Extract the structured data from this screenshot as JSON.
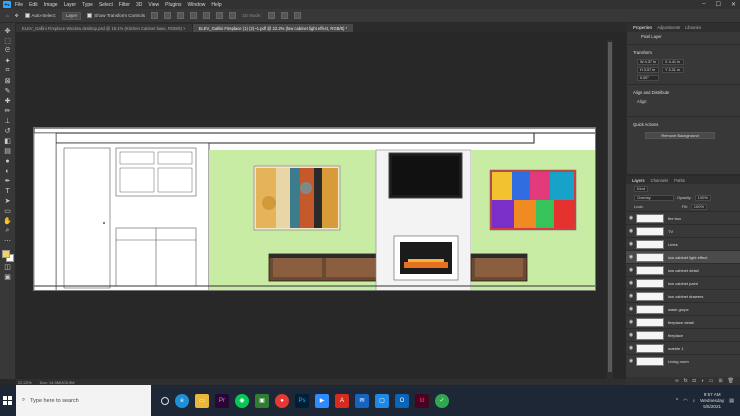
{
  "menubar": {
    "logo": "Ps",
    "items": [
      "File",
      "Edit",
      "Image",
      "Layer",
      "Type",
      "Select",
      "Filter",
      "3D",
      "View",
      "Plugins",
      "Window",
      "Help"
    ],
    "window_controls": [
      "–",
      "☐",
      "✕"
    ]
  },
  "options_bar": {
    "auto_select_label": "Auto-Select:",
    "auto_select_value": "Layer",
    "transform_controls_label": "Show Transform Controls",
    "mode_3d_label": "3D Mode:"
  },
  "tabs": [
    {
      "label": "ELEV_Gallini Fireplace Window desktop.psd @ 16.1% (Kitchen Cabinet base, RGB/8) ×",
      "active": false
    },
    {
      "label": "ELEV_Gallini Fireplace (1) (2)~1.pdf @ 22.2% (low cabinet light effect, RGB/8) *",
      "active": true
    }
  ],
  "status": {
    "zoom": "22.22%",
    "doc": "Doc: 14.9M/205.9M"
  },
  "properties": {
    "tabs": [
      "Properties",
      "Adjustments",
      "Libraries"
    ],
    "layer_type": "Pixel Layer",
    "transform_heading": "Transform",
    "w": "W  4.37 in",
    "h": "H  3.57 in",
    "x": "X  4.41 in",
    "y": "Y  3.31 in",
    "angle": "0.00°",
    "align_heading": "Align and Distribute",
    "align_sub": "Align:",
    "quick_heading": "Quick Actions",
    "remove_bg": "Remove Background"
  },
  "layers": {
    "tabs": [
      "Layers",
      "Channels",
      "Paths"
    ],
    "filter": "Kind",
    "blend_mode": "Overlay",
    "opacity_label": "Opacity:",
    "opacity_value": "100%",
    "lock_label": "Lock:",
    "fill_label": "Fill:",
    "fill_value": "100%",
    "items": [
      {
        "name": "fire box",
        "selected": false
      },
      {
        "name": "TV",
        "selected": false
      },
      {
        "name": "Lines",
        "selected": false
      },
      {
        "name": "low cabinet light effect",
        "selected": true
      },
      {
        "name": "low cabinet detail",
        "selected": false
      },
      {
        "name": "low cabinet paint",
        "selected": false
      },
      {
        "name": "low cabinet drawers",
        "selected": false
      },
      {
        "name": "wash grupe",
        "selected": false
      },
      {
        "name": "fireplace detail",
        "selected": false
      },
      {
        "name": "fireplace",
        "selected": false
      },
      {
        "name": "marble 1",
        "selected": false
      },
      {
        "name": "Living room",
        "selected": false
      }
    ]
  },
  "taskbar": {
    "search_placeholder": "Type here to search",
    "time": "9:57 AM",
    "day": "Wednesday",
    "date": "5/5/2021"
  },
  "colors": {
    "wall_green": "#c8eca3",
    "ps_blue": "#31a8ff",
    "taskbar": "#1d2736"
  }
}
